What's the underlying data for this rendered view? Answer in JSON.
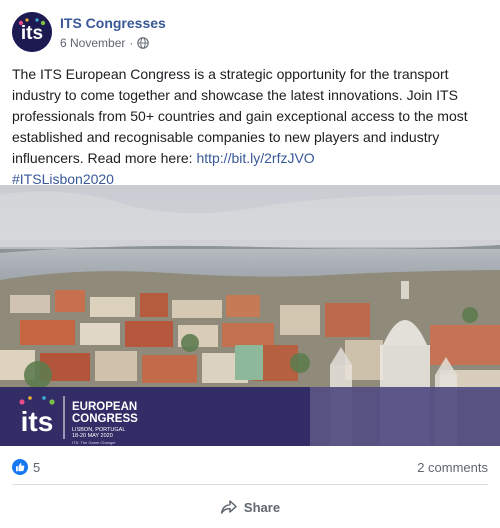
{
  "post": {
    "page_name": "ITS Congresses",
    "date": "6 November",
    "privacy_icon": "globe-icon",
    "text_main": "The ITS European Congress is a strategic opportunity for the transport industry to come together and showcase the latest innovations. Join ITS professionals from 50+ countries and gain exceptional access to the most established and recognisable companies to new players and industry influencers. Read more here: ",
    "link": "http://bit.ly/2rfzJVO",
    "hashtag": "#ITSLisbon2020"
  },
  "banner": {
    "logo_text": "its",
    "line1": "EUROPEAN",
    "line2": "CONGRESS",
    "location": "LISBON, PORTUGAL",
    "dates": "18-20 MAY 2020",
    "tagline": "ITS: The Game Changer"
  },
  "footer": {
    "likes_count": "5",
    "comments": "2 comments",
    "share_label": "Share"
  },
  "colors": {
    "link": "#385898",
    "banner": "#2a2565",
    "like": "#1877f2"
  }
}
